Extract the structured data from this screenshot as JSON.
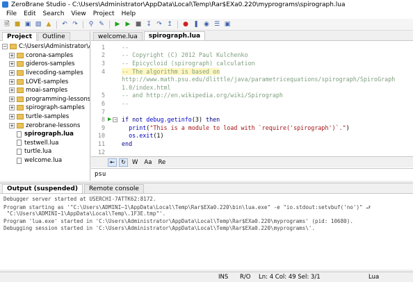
{
  "window": {
    "title": "ZeroBrane Studio - C:\\Users\\Administrator\\AppData\\Local\\Temp\\Rar$EXa0.220\\myprograms\\spirograph.lua"
  },
  "menu": [
    "File",
    "Edit",
    "Search",
    "View",
    "Project",
    "Help"
  ],
  "toolbar": {
    "icons": [
      "new-file-icon",
      "open-icon",
      "save-icon",
      "save-all-icon",
      "project-dir-icon",
      "undo-icon",
      "redo-icon",
      "find-icon",
      "replace-icon",
      "run-icon",
      "start-debug-icon",
      "stop-icon",
      "step-into-icon",
      "step-over-icon",
      "step-out-icon",
      "breakpoint-icon",
      "break-icon",
      "watch-icon",
      "stack-icon",
      "console-icon"
    ]
  },
  "left_panel": {
    "tabs": [
      "Project",
      "Outline"
    ],
    "root": "C:\\Users\\Administrator\\App",
    "folders": [
      "corona-samples",
      "gideros-samples",
      "livecoding-samples",
      "LOVE-samples",
      "moai-samples",
      "programming-lessons",
      "spirograph-samples",
      "turtle-samples",
      "zerobrane-lessons"
    ],
    "files": [
      "spirograph.lua",
      "testwell.lua",
      "turtle.lua",
      "welcome.lua"
    ]
  },
  "editor": {
    "tabs": [
      "welcome.lua",
      "spirograph.lua"
    ],
    "lines": [
      {
        "n": "1",
        "segments": [
          {
            "t": "--",
            "c": "comment"
          }
        ]
      },
      {
        "n": "2",
        "segments": [
          {
            "t": "-- Copyright (C) 2012 Paul Kulchenko",
            "c": "comment"
          }
        ]
      },
      {
        "n": "3",
        "segments": [
          {
            "t": "-- Epicycloid (spirograph) calculation",
            "c": "comment"
          }
        ]
      },
      {
        "n": "4",
        "segments": [
          {
            "t": "-- The algorithm is based on",
            "c": "comment hl"
          }
        ]
      },
      {
        "n": "",
        "segments": [
          {
            "t": "http://www.math.psu.edu/dlittle/java/parametricequations/spirograph/SpiroGraph",
            "c": "comment"
          }
        ]
      },
      {
        "n": "",
        "segments": [
          {
            "t": "1.0/index.html",
            "c": "comment"
          }
        ]
      },
      {
        "n": "5",
        "segments": [
          {
            "t": "-- and http://en.wikipedia.org/wiki/Spirograph",
            "c": "comment"
          }
        ]
      },
      {
        "n": "6",
        "segments": [
          {
            "t": "--",
            "c": "comment"
          }
        ]
      },
      {
        "n": "7",
        "segments": [
          {
            "t": "",
            "c": "plain"
          }
        ]
      },
      {
        "n": "8",
        "segments": [
          {
            "t": "if not ",
            "c": "kw"
          },
          {
            "t": "debug.getinfo",
            "c": "fn"
          },
          {
            "t": "(3) ",
            "c": "plain"
          },
          {
            "t": "then",
            "c": "kw"
          }
        ],
        "arrow": true,
        "fold": true
      },
      {
        "n": "9",
        "segments": [
          {
            "t": "  print",
            "c": "fn"
          },
          {
            "t": "(",
            "c": "plain"
          },
          {
            "t": "\"This is a module to load with `require('spirograph')`.\"",
            "c": "str"
          },
          {
            "t": ")",
            "c": "plain"
          }
        ]
      },
      {
        "n": "10",
        "segments": [
          {
            "t": "  os.exit",
            "c": "fn"
          },
          {
            "t": "(1)",
            "c": "plain"
          }
        ]
      },
      {
        "n": "11",
        "segments": [
          {
            "t": "end",
            "c": "kw"
          }
        ]
      },
      {
        "n": "12",
        "segments": [
          {
            "t": "",
            "c": "plain"
          }
        ]
      }
    ]
  },
  "find": {
    "options": [
      "W",
      "Aa",
      "Re"
    ],
    "value": "psu"
  },
  "output": {
    "tabs": [
      "Output (suspended)",
      "Remote console"
    ],
    "lines": [
      "Debugger server started at USERCHI-7ATTK62:8172.",
      "Program starting as '\"C:\\Users\\ADMINI~1\\AppData\\Local\\Temp\\Rar$EXa0.220\\bin\\lua.exe\" -e \"io.stdout:setvbuf('no')\" ⮐",
      " \"C:\\Users\\ADMINI~1\\AppData\\Local\\Temp\\.1F3E.tmp\"'.",
      "Program 'lua.exe' started in 'C:\\Users\\Administrator\\AppData\\Local\\Temp\\Rar$EXa0.220\\myprograms' (pid: 10680).",
      "Debugging session started in 'C:\\Users\\Administrator\\AppData\\Local\\Temp\\Rar$EXa0.220\\myprograms\\'."
    ]
  },
  "status": {
    "ins": "INS",
    "ro": "R/O",
    "position": "Ln: 4 Col: 49 Sel: 3/1",
    "lang": "Lua"
  }
}
